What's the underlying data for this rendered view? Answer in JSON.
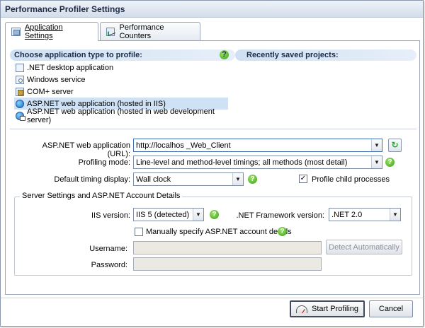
{
  "window": {
    "title": "Performance Profiler Settings"
  },
  "tabs": [
    {
      "label": "Application Settings",
      "icon": "settings-icon",
      "active": true
    },
    {
      "label": "Performance Counters",
      "icon": "chart-icon",
      "active": false
    }
  ],
  "app_section": {
    "header": "Choose application type to profile:",
    "items": [
      {
        "label": ".NET desktop application",
        "icon": "desktop-app-icon",
        "selected": false
      },
      {
        "label": "Windows service",
        "icon": "service-icon",
        "selected": false
      },
      {
        "label": "COM+ server",
        "icon": "com-server-icon",
        "selected": false
      },
      {
        "label": "ASP.NET web application (hosted in IIS)",
        "icon": "globe-icon",
        "selected": true
      },
      {
        "label": "ASP.NET web application (hosted in web development server)",
        "icon": "globe-dev-icon",
        "selected": false
      }
    ]
  },
  "recent_section": {
    "header": "Recently saved projects:"
  },
  "form": {
    "url_label": "ASP.NET web application (URL):",
    "url_value": "http://localhos        _Web_Client",
    "profiling_mode_label": "Profiling mode:",
    "profiling_mode_value": "Line-level and method-level timings; all methods (most detail)",
    "timing_display_label": "Default timing display:",
    "timing_display_value": "Wall clock",
    "profile_child_label": "Profile child processes",
    "profile_child_checked": true
  },
  "server": {
    "group_title": "Server Settings and ASP.NET Account Details",
    "iis_label": "IIS version:",
    "iis_value": "IIS 5 (detected)",
    "framework_label": ".NET Framework version:",
    "framework_value": ".NET 2.0",
    "manual_account_label": "Manually specify ASP.NET account details",
    "manual_account_checked": false,
    "username_label": "Username:",
    "password_label": "Password:",
    "detect_button": "Detect Automatically"
  },
  "footer": {
    "start_button": "Start Profiling",
    "cancel_button": "Cancel"
  },
  "glyphs": {
    "help": "?",
    "arrow": "▼",
    "refresh": "↻",
    "check": "✓"
  },
  "colors": {
    "selection": "#cfe1f4",
    "header_band": "#cfe0f2",
    "help_green": "#39a315"
  }
}
